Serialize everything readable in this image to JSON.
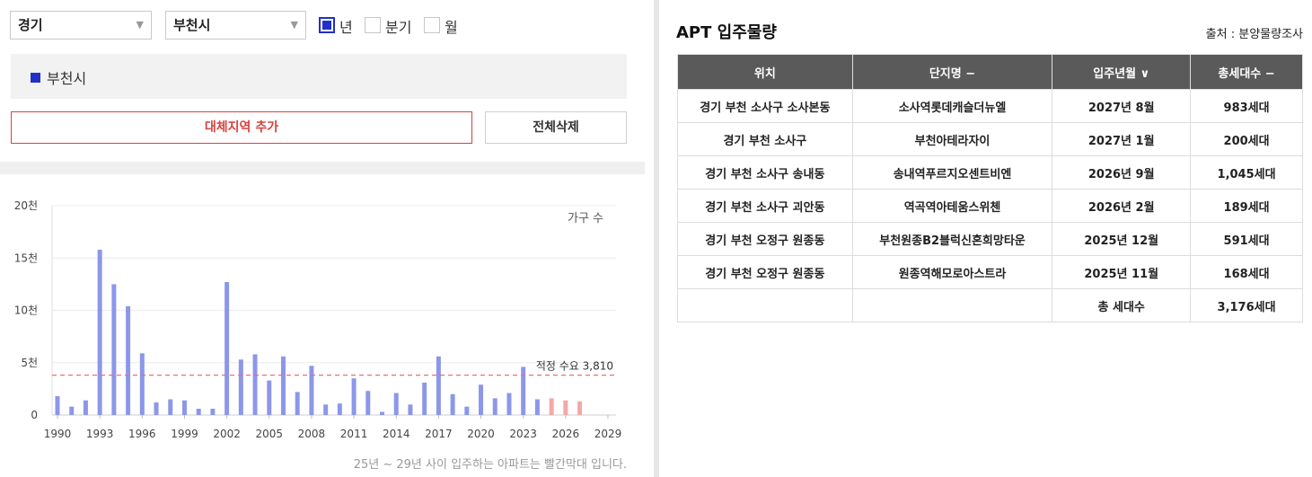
{
  "filters": {
    "province": "경기",
    "city": "부천시",
    "period_options": [
      {
        "label": "년",
        "checked": true
      },
      {
        "label": "분기",
        "checked": false
      },
      {
        "label": "월",
        "checked": false
      }
    ]
  },
  "region_list": [
    "부천시"
  ],
  "buttons": {
    "add_region": "대체지역 추가",
    "delete_all": "전체삭제"
  },
  "colors": {
    "past_bar": "#8c97ea",
    "future_bar": "#f4a8a8",
    "demand_line": "#e87070",
    "accent": "#2230c8"
  },
  "chart_data": {
    "type": "bar",
    "unit_label": "가구 수",
    "y_ticks": [
      "0",
      "5천",
      "10천",
      "15천",
      "20천"
    ],
    "ylim": [
      0,
      20000
    ],
    "x_ticks": [
      "1990",
      "1993",
      "1996",
      "1999",
      "2002",
      "2005",
      "2008",
      "2011",
      "2014",
      "2017",
      "2020",
      "2023",
      "2026",
      "2029"
    ],
    "x": [
      1990,
      1991,
      1992,
      1993,
      1994,
      1995,
      1996,
      1997,
      1998,
      1999,
      2000,
      2001,
      2002,
      2003,
      2004,
      2005,
      2006,
      2007,
      2008,
      2009,
      2010,
      2011,
      2012,
      2013,
      2014,
      2015,
      2016,
      2017,
      2018,
      2019,
      2020,
      2021,
      2022,
      2023,
      2024,
      2025,
      2026,
      2027
    ],
    "values": [
      1800,
      800,
      1400,
      15800,
      12500,
      10400,
      5900,
      1200,
      1500,
      1400,
      600,
      600,
      12700,
      5300,
      5800,
      3300,
      5600,
      2200,
      4700,
      1000,
      1100,
      3500,
      2300,
      300,
      2100,
      1000,
      3100,
      5600,
      2000,
      800,
      2900,
      1600,
      2100,
      4600,
      1500,
      1600,
      1400,
      1300
    ],
    "highlight_from": 2025,
    "demand_line": {
      "value": 3810,
      "label": "적정 수요 3,810"
    },
    "grid": true
  },
  "footnote": "25년 ~ 29년 사이 입주하는 아파트는 빨간막대 입니다.",
  "panel": {
    "title": "APT 입주물량",
    "source": "출처 : 분양물량조사",
    "columns": [
      "위치",
      "단지명 −",
      "입주년월 ∨",
      "총세대수 −"
    ],
    "rows": [
      [
        "경기 부천 소사구 소사본동",
        "소사역롯데캐슬더뉴엘",
        "2027년 8월",
        "983세대"
      ],
      [
        "경기 부천 소사구",
        "부천아테라자이",
        "2027년 1월",
        "200세대"
      ],
      [
        "경기 부천 소사구 송내동",
        "송내역푸르지오센트비엔",
        "2026년 9월",
        "1,045세대"
      ],
      [
        "경기 부천 소사구 괴안동",
        "역곡역아테움스위첸",
        "2026년 2월",
        "189세대"
      ],
      [
        "경기 부천 오정구 원종동",
        "부천원종B2블럭신혼희망타운",
        "2025년 12월",
        "591세대"
      ],
      [
        "경기 부천 오정구 원종동",
        "원종역해모로아스트라",
        "2025년 11월",
        "168세대"
      ]
    ],
    "total_label": "총 세대수",
    "total_value": "3,176세대"
  }
}
